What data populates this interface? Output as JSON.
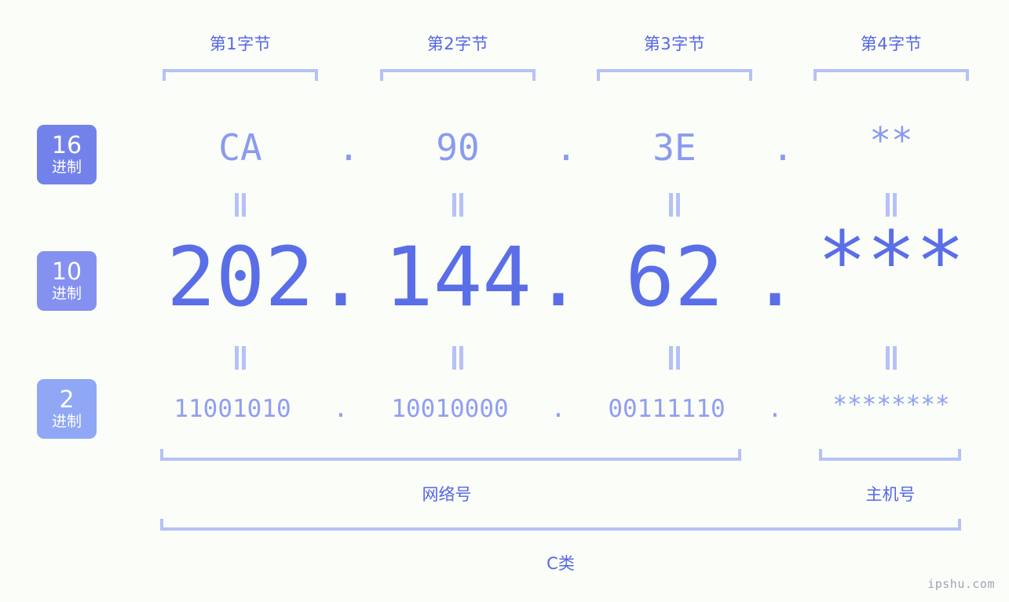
{
  "background_color": "#fbfdf8",
  "accent_color": "#5566e8",
  "bracket_color": "#b6c1f7",
  "byte_headers": [
    {
      "label": "第1字节"
    },
    {
      "label": "第2字节"
    },
    {
      "label": "第3字节"
    },
    {
      "label": "第4字节"
    }
  ],
  "rows": [
    {
      "badge_number": "16",
      "badge_suffix": "进制",
      "badge_color": "#7382ea",
      "text_color": "#8a9bef",
      "values": [
        "CA",
        "90",
        "3E",
        "**"
      ],
      "separator": "."
    },
    {
      "badge_number": "10",
      "badge_suffix": "进制",
      "badge_color": "#8591f0",
      "text_color": "#5a6ee8",
      "values": [
        "202",
        "144",
        "62",
        "***"
      ],
      "separator": "."
    },
    {
      "badge_number": "2",
      "badge_suffix": "进制",
      "badge_color": "#8fa7f5",
      "text_color": "#909fef",
      "values": [
        "11001010",
        "10010000",
        "00111110",
        "********"
      ],
      "separator": "."
    }
  ],
  "equals_marks": {
    "glyph": "=",
    "count_per_gap": 4
  },
  "sections": [
    {
      "label": "网络号"
    },
    {
      "label": "主机号"
    }
  ],
  "ip_class": {
    "label": "C类"
  },
  "watermark": {
    "text": "ipshu.com"
  }
}
